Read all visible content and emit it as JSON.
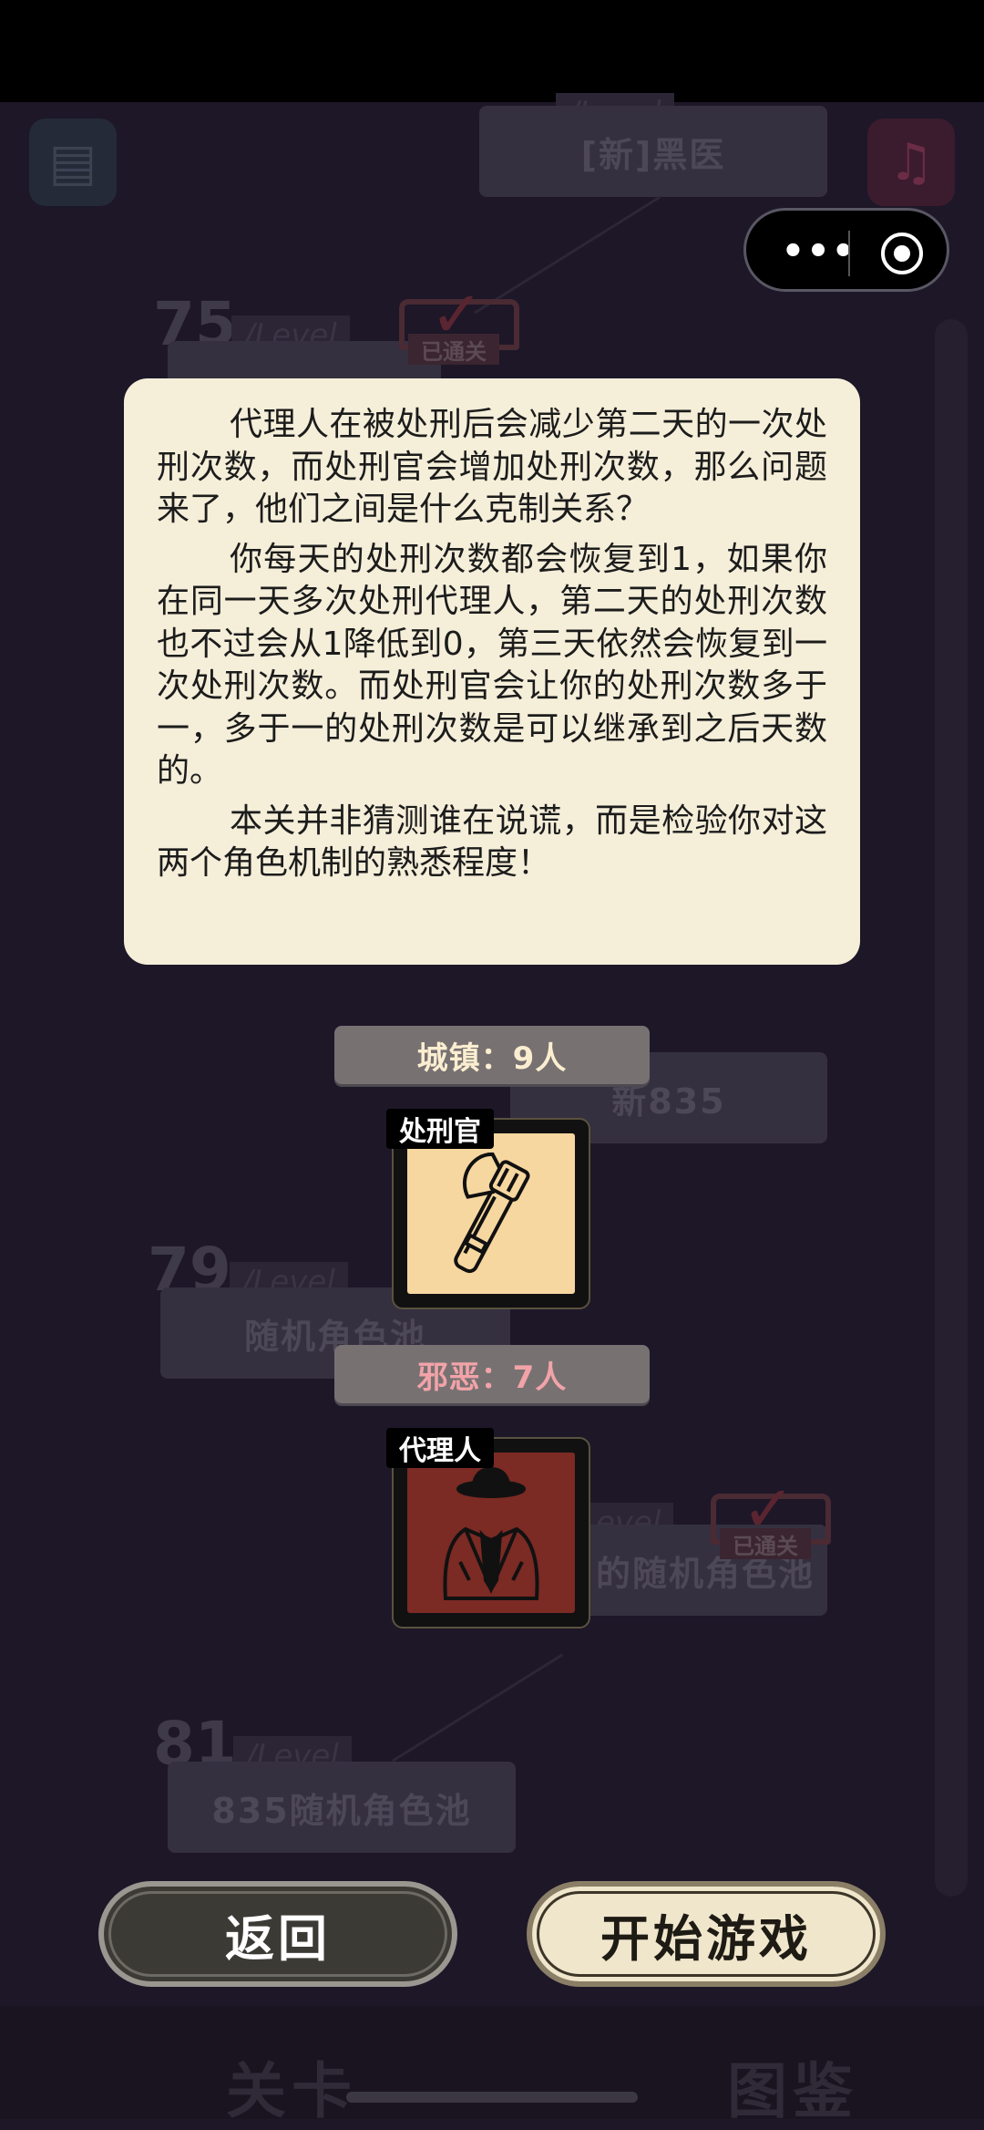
{
  "background": {
    "levels": [
      {
        "number": "75",
        "tag": "/Level",
        "name": "",
        "cleared_label": "已通关"
      },
      {
        "number": "79",
        "tag": "/Level",
        "name": "随机角色池"
      },
      {
        "number": "81",
        "tag": "/Level",
        "name": "835随机角色池"
      }
    ],
    "top_card": {
      "tag": "/Level",
      "name": "[新]黑医"
    },
    "mid_card": {
      "name": "新835"
    },
    "lower_card": {
      "tag": "evel",
      "name": "的随机角色池",
      "cleared_label": "已通关"
    }
  },
  "popup": {
    "paragraphs": [
      "代理人在被处刑后会减少第二天的一次处刑次数，而处刑官会增加处刑次数，那么问题来了，他们之间是什么克制关系？",
      "你每天的处刑次数都会恢复到1，如果你在同一天多次处刑代理人，第二天的处刑次数也不过会从1降低到0，第三天依然会恢复到一次处刑次数。而处刑官会让你的处刑次数多于一，多于一的处刑次数是可以继承到之后天数的。",
      "本关并非猜测谁在说谎，而是检验你对这两个角色机制的熟悉程度！"
    ]
  },
  "factions": {
    "town": {
      "label": "城镇：9人",
      "role": "处刑官",
      "role_icon": "axe-icon"
    },
    "evil": {
      "label": "邪恶：7人",
      "role": "代理人",
      "role_icon": "suited-agent-icon"
    }
  },
  "buttons": {
    "back": "返回",
    "start": "开始游戏"
  },
  "tabs": {
    "levels": "关卡",
    "codex": "图鉴"
  },
  "capsule": {
    "more": "•••"
  },
  "colors": {
    "popup_bg": "#f5eed9",
    "town_text": "#fbeed0",
    "evil_text": "#f2a3a8",
    "page_bg": "#1d1728"
  }
}
